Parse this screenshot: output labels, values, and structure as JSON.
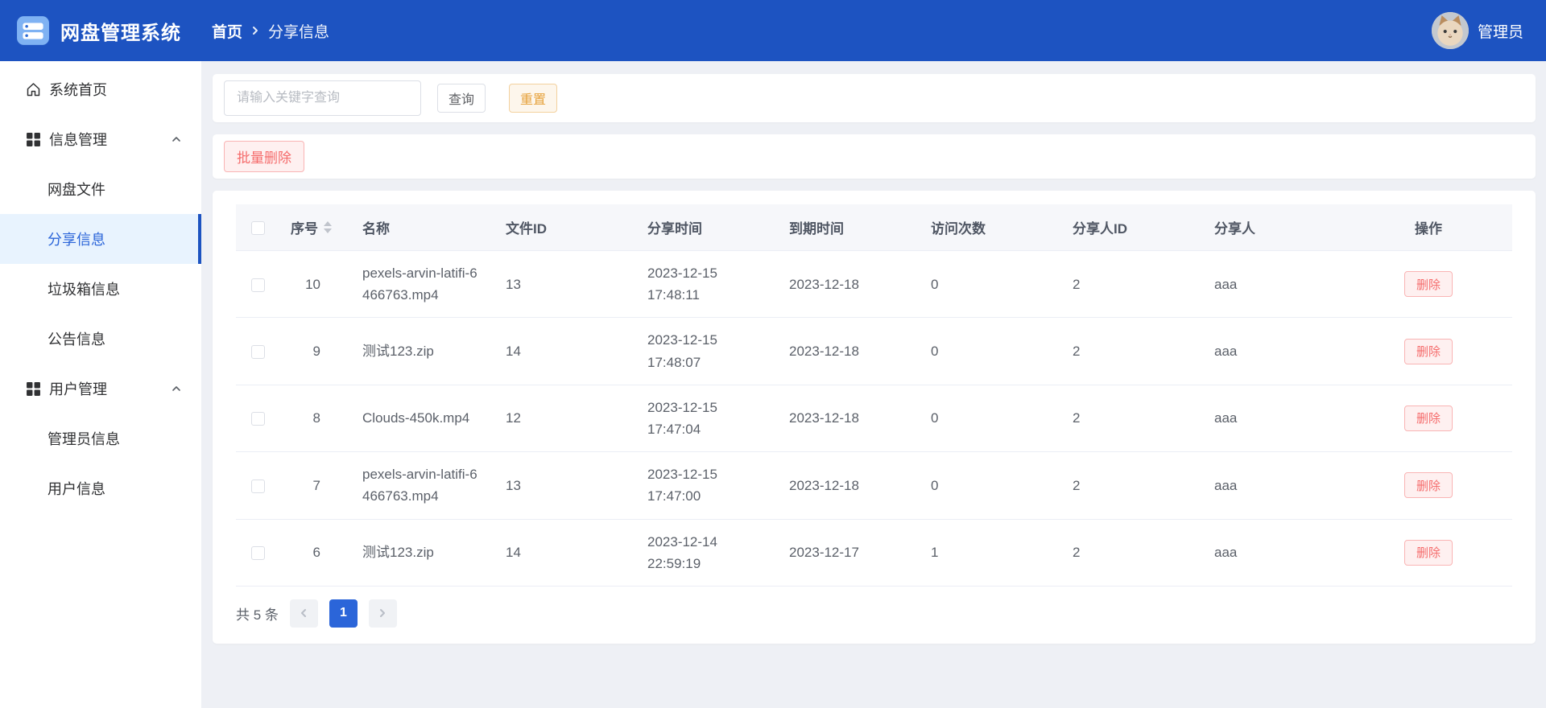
{
  "colors": {
    "primary": "#1d53c1",
    "active_blue": "#2b65d9",
    "active_item_bg": "#e8f3fe",
    "danger": "#f56c6c",
    "danger_bg": "#fef0f0",
    "warning": "#e6a23c",
    "warning_bg": "#fdf6ec",
    "page_bg": "#eef0f5"
  },
  "header": {
    "app_title": "网盘管理系统",
    "breadcrumb_home": "首页",
    "breadcrumb_current": "分享信息",
    "user_name": "管理员"
  },
  "sidebar": {
    "items": [
      {
        "label": "系统首页",
        "icon": "home-icon"
      },
      {
        "label": "信息管理",
        "icon": "grid-icon",
        "expanded": true
      },
      {
        "label": "网盘文件"
      },
      {
        "label": "分享信息",
        "active": true
      },
      {
        "label": "垃圾箱信息"
      },
      {
        "label": "公告信息"
      },
      {
        "label": "用户管理",
        "icon": "grid-icon",
        "expanded": true
      },
      {
        "label": "管理员信息"
      },
      {
        "label": "用户信息"
      }
    ]
  },
  "search": {
    "placeholder": "请输入关键字查询",
    "query_label": "查询",
    "reset_label": "重置"
  },
  "actions": {
    "batch_delete_label": "批量删除"
  },
  "table": {
    "columns": [
      "序号",
      "名称",
      "文件ID",
      "分享时间",
      "到期时间",
      "访问次数",
      "分享人ID",
      "分享人",
      "操作"
    ],
    "delete_label": "删除",
    "rows": [
      {
        "seq": "10",
        "name": "pexels-arvin-latifi-6466763.mp4",
        "file_id": "13",
        "share_time": "2023-12-15 17:48:11",
        "expire_time": "2023-12-18",
        "visits": "0",
        "sharer_id": "2",
        "sharer": "aaa"
      },
      {
        "seq": "9",
        "name": "测试123.zip",
        "file_id": "14",
        "share_time": "2023-12-15 17:48:07",
        "expire_time": "2023-12-18",
        "visits": "0",
        "sharer_id": "2",
        "sharer": "aaa"
      },
      {
        "seq": "8",
        "name": "Clouds-450k.mp4",
        "file_id": "12",
        "share_time": "2023-12-15 17:47:04",
        "expire_time": "2023-12-18",
        "visits": "0",
        "sharer_id": "2",
        "sharer": "aaa"
      },
      {
        "seq": "7",
        "name": "pexels-arvin-latifi-6466763.mp4",
        "file_id": "13",
        "share_time": "2023-12-15 17:47:00",
        "expire_time": "2023-12-18",
        "visits": "0",
        "sharer_id": "2",
        "sharer": "aaa"
      },
      {
        "seq": "6",
        "name": "测试123.zip",
        "file_id": "14",
        "share_time": "2023-12-14 22:59:19",
        "expire_time": "2023-12-17",
        "visits": "1",
        "sharer_id": "2",
        "sharer": "aaa"
      }
    ]
  },
  "pagination": {
    "total_text": "共 5 条",
    "current_page": "1"
  }
}
